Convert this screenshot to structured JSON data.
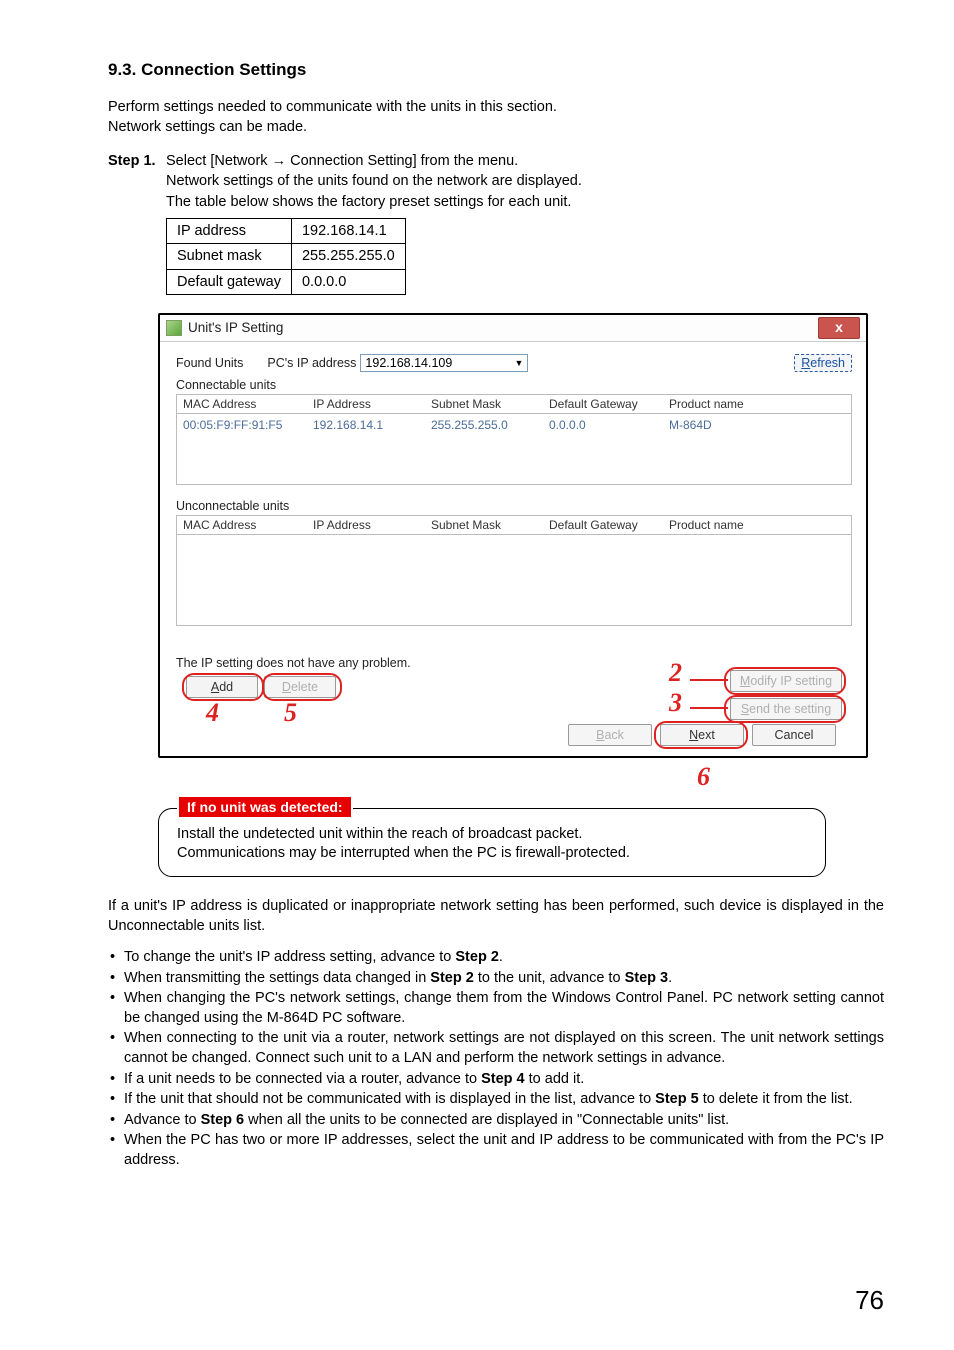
{
  "section_title": "9.3. Connection Settings",
  "intro": {
    "l1": "Perform settings needed to communicate with the units in this section.",
    "l2": "Network settings can be made."
  },
  "step1": {
    "label": "Step 1.",
    "l1": "Select [Network → Connection Setting] from the menu.",
    "l2": "Network settings of the units found on the network are displayed.",
    "l3": "The table below shows the factory preset settings for each unit."
  },
  "factory_table": [
    [
      "IP address",
      "192.168.14.1"
    ],
    [
      "Subnet mask",
      "255.255.255.0"
    ],
    [
      "Default gateway",
      "0.0.0.0"
    ]
  ],
  "dialog": {
    "title": "Unit's IP Setting",
    "close": "x",
    "found_units": "Found Units",
    "pc_ip_label": "PC's IP address",
    "pc_ip_value": "192.168.14.109",
    "refresh_pre": "R",
    "refresh_post": "efresh",
    "connectable": "Connectable units",
    "unconnectable": "Unconnectable units",
    "headers": {
      "mac": "MAC Address",
      "ip": "IP Address",
      "subnet": "Subnet Mask",
      "gateway": "Default Gateway",
      "product": "Product name"
    },
    "row1": {
      "mac": "00:05:F9:FF:91:F5",
      "ip": "192.168.14.1",
      "subnet": "255.255.255.0",
      "gateway": "0.0.0.0",
      "product": "M-864D"
    },
    "status": "The IP setting does not have any problem.",
    "btn": {
      "add_pre": "A",
      "add_post": "dd",
      "delete_pre": "D",
      "delete_post": "elete",
      "modify_pre": "M",
      "modify_post": "odify IP setting",
      "send_pre": "S",
      "send_post": "end the setting",
      "back_pre": "B",
      "back_post": "ack",
      "next_pre": "N",
      "next_post": "ext",
      "cancel": "Cancel"
    }
  },
  "callouts": {
    "n2": "2",
    "n3": "3",
    "n4": "4",
    "n5": "5",
    "n6": "6"
  },
  "note": {
    "title": "If no unit was detected:",
    "l1": "Install the undetected unit within the reach of broadcast packet.",
    "l2": "Communications may be interrupted when the PC is firewall-protected."
  },
  "after": {
    "para": "If a unit's IP address is duplicated or inappropriate network setting has been performed, such device is displayed in the Unconnectable units list.",
    "bullets": {
      "b1a": "To change the unit's IP address setting, advance to ",
      "b1b": "Step 2",
      "b1c": ".",
      "b2a": "When transmitting the settings data changed in ",
      "b2b": "Step 2",
      "b2c": " to the unit, advance to ",
      "b2d": "Step 3",
      "b2e": ".",
      "b3": "When changing the PC's network settings, change them from the Windows Control Panel. PC network setting cannot be changed using the M-864D PC software.",
      "b4": "When connecting to the unit via a router, network settings are not displayed on this screen. The unit network settings cannot be changed. Connect such unit to a LAN and perform the network settings in advance.",
      "b5a": "If a unit needs to be connected via a router, advance to ",
      "b5b": "Step 4",
      "b5c": " to add it.",
      "b6a": "If the unit that should not be communicated with is displayed in the list, advance to ",
      "b6b": "Step 5",
      "b6c": " to delete it from the list.",
      "b7a": "Advance to ",
      "b7b": "Step 6",
      "b7c": " when all the units to be connected are displayed in \"Connectable units\" list.",
      "b8": "When the PC has two or more IP addresses, select the unit and IP address to be communicated with from the PC's IP address."
    }
  },
  "page_number": "76"
}
